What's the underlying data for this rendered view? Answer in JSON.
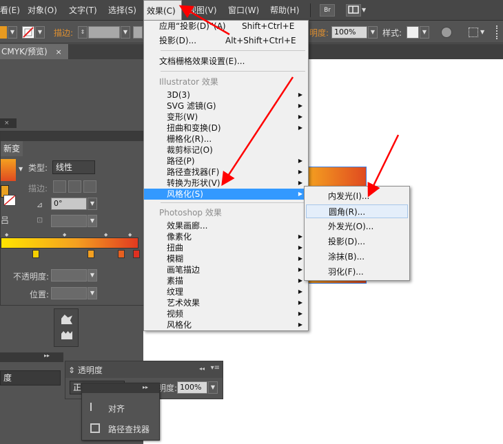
{
  "menubar": {
    "items": [
      "看(E)",
      "对象(O)",
      "文字(T)",
      "选择(S)",
      "效果(C)",
      "视图(V)",
      "窗口(W)",
      "帮助(H)"
    ],
    "bridge_label": "Br"
  },
  "controlbar": {
    "stroke_label": "描边:",
    "opacity_label": "明度:",
    "opacity_value": "100%",
    "style_label": "样式:"
  },
  "doc_tab": {
    "title": "CMYK/预览)",
    "close": "×"
  },
  "gradient_panel": {
    "tab_label": "新变",
    "type_label": "类型:",
    "type_value": "线性",
    "stroke_label": "描边:",
    "angle_value": "0°",
    "opacity_label": "不透明度:",
    "position_label": "位置:",
    "gradient_start": "#ffd700",
    "gradient_end": "#e03020"
  },
  "effect_menu": {
    "apply_label": "应用“投影(D)”(A)",
    "apply_shortcut": "Shift+Ctrl+E",
    "shadow_label": "投影(D)...",
    "shadow_shortcut": "Alt+Shift+Ctrl+E",
    "raster_settings": "文档栅格效果设置(E)...",
    "illustrator_header": "Illustrator 效果",
    "illustrator_items": [
      "3D(3)",
      "SVG 滤镜(G)",
      "变形(W)",
      "扭曲和变换(D)",
      "栅格化(R)...",
      "裁剪标记(O)",
      "路径(P)",
      "路径查找器(F)",
      "转换为形状(V)",
      "风格化(S)"
    ],
    "photoshop_header": "Photoshop 效果",
    "photoshop_items": [
      "效果画廊...",
      "像素化",
      "扭曲",
      "模糊",
      "画笔描边",
      "素描",
      "纹理",
      "艺术效果",
      "视频",
      "风格化"
    ]
  },
  "stylize_submenu": {
    "items": [
      "内发光(I)...",
      "圆角(R)...",
      "外发光(O)...",
      "投影(D)...",
      "涂抹(B)...",
      "羽化(F)..."
    ]
  },
  "transparency_panel": {
    "title": "透明度",
    "mode_prefix": "正",
    "opacity_label": "明度:",
    "opacity_value": "100%"
  },
  "left_bottom_panel": {
    "label": "度"
  },
  "align_panel": {
    "items": [
      "对齐",
      "路径查找器"
    ]
  },
  "colors": {
    "menu_highlight": "#3399ff",
    "arrow": "#ff0000"
  }
}
